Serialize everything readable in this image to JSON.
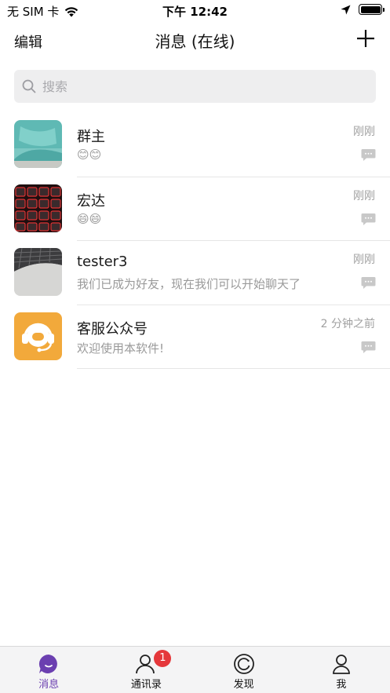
{
  "status_bar": {
    "carrier": "无 SIM 卡",
    "time": "下午 12:42"
  },
  "nav": {
    "left_label": "编辑",
    "title": "消息 (在线)"
  },
  "search": {
    "placeholder": "搜索"
  },
  "conversations": [
    {
      "name": "群主",
      "preview": "😊😊",
      "time": "刚刚"
    },
    {
      "name": "宏达",
      "preview": "😄😄",
      "time": "刚刚"
    },
    {
      "name": "tester3",
      "preview": "我们已成为好友，现在我们可以开始聊天了",
      "time": "刚刚"
    },
    {
      "name": "客服公众号",
      "preview": "欢迎使用本软件!",
      "time": "2 分钟之前"
    }
  ],
  "tabs": [
    {
      "label": "消息",
      "active": true
    },
    {
      "label": "通讯录",
      "badge": "1"
    },
    {
      "label": "发现"
    },
    {
      "label": "我"
    }
  ],
  "colors": {
    "accent": "#6b3fb0",
    "badge": "#e5383b",
    "service_avatar": "#f2a93b"
  }
}
